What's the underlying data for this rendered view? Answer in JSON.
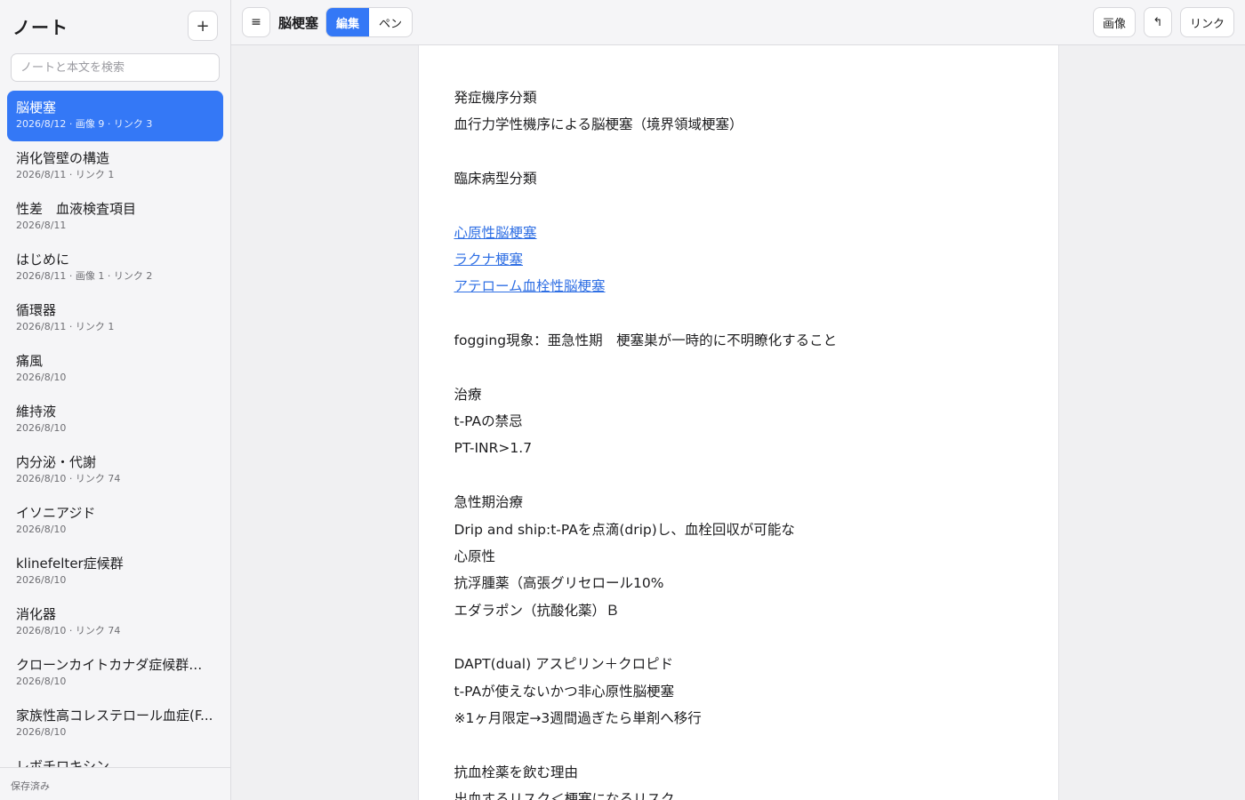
{
  "sidebar": {
    "title": "ノート",
    "add_label": "+",
    "search_placeholder": "ノートと本文を検索",
    "notes": [
      {
        "title": "脳梗塞",
        "meta": "2026/8/12 · 画像 9 · リンク 3",
        "active": true
      },
      {
        "title": "消化管壁の構造",
        "meta": "2026/8/11 · リンク 1"
      },
      {
        "title": "性差　血液検査項目",
        "meta": "2026/8/11"
      },
      {
        "title": "はじめに",
        "meta": "2026/8/11 · 画像 1 · リンク 2"
      },
      {
        "title": "循環器",
        "meta": "2026/8/11 · リンク 1"
      },
      {
        "title": "痛風",
        "meta": "2026/8/10"
      },
      {
        "title": "維持液",
        "meta": "2026/8/10"
      },
      {
        "title": "内分泌・代謝",
        "meta": "2026/8/10 · リンク 74"
      },
      {
        "title": "イソニアジド",
        "meta": "2026/8/10"
      },
      {
        "title": "klinefelter症候群",
        "meta": "2026/8/10"
      },
      {
        "title": "消化器",
        "meta": "2026/8/10 · リンク 74"
      },
      {
        "title": "クローンカイトカナダ症候群　 ...",
        "meta": "2026/8/10"
      },
      {
        "title": "家族性高コレステロール血症(F...",
        "meta": "2026/8/10"
      },
      {
        "title": "レボチロキシン",
        "meta": ""
      }
    ],
    "status": "保存済み"
  },
  "toolbar": {
    "menu_label": "≡",
    "doc_title": "脳梗塞",
    "mode_edit": "編集",
    "mode_pen": "ペン",
    "image_label": "画像",
    "undo_label": "↰",
    "link_label": "リンク"
  },
  "document": {
    "lines": [
      {
        "text": "発症機序分類"
      },
      {
        "text": "血行力学性機序による脳梗塞（境界領域梗塞）"
      },
      {
        "text": ""
      },
      {
        "text": "臨床病型分類"
      },
      {
        "text": ""
      },
      {
        "text": "心原性脳梗塞",
        "link": true
      },
      {
        "text": "ラクナ梗塞",
        "link": true
      },
      {
        "text": "アテローム血栓性脳梗塞",
        "link": true
      },
      {
        "text": ""
      },
      {
        "text": "fogging現象：亜急性期　梗塞巣が一時的に不明瞭化すること"
      },
      {
        "text": ""
      },
      {
        "text": "治療"
      },
      {
        "text": "t-PAの禁忌"
      },
      {
        "text": "PT-INR>1.7"
      },
      {
        "text": ""
      },
      {
        "text": "急性期治療"
      },
      {
        "text": "Drip and ship:t-PAを点滴(drip)し、血栓回収が可能な"
      },
      {
        "text": "心原性"
      },
      {
        "text": "抗浮腫薬（高張グリセロール10%"
      },
      {
        "text": "エダラポン（抗酸化薬）Ｂ"
      },
      {
        "text": ""
      },
      {
        "text": "DAPT(dual) アスピリン＋クロピド"
      },
      {
        "text": "t-PAが使えないかつ非心原性脳梗塞"
      },
      {
        "text": "※1ヶ月限定→3週間過ぎたら単剤へ移行"
      },
      {
        "text": ""
      },
      {
        "text": "抗血栓薬を飲む理由"
      },
      {
        "text": "出血するリスク＜梗塞になるリスク"
      }
    ]
  }
}
